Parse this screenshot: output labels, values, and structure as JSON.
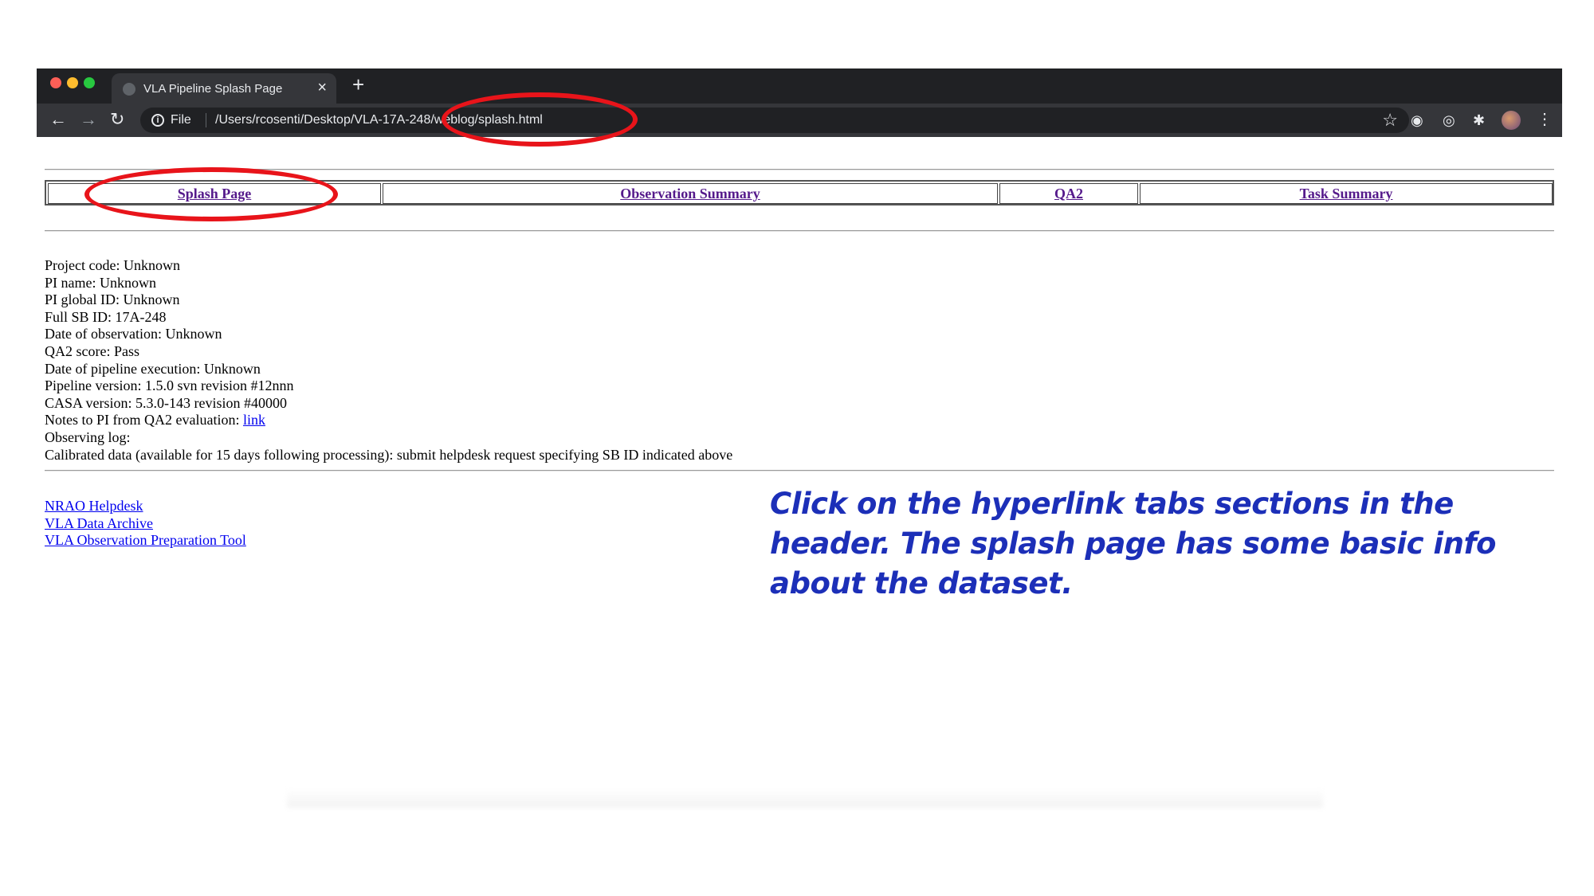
{
  "browser": {
    "tab_title": "VLA Pipeline Splash Page",
    "tab_close": "×",
    "new_tab": "+",
    "scheme_label": "File",
    "url": "/Users/rcosenti/Desktop/VLA-17A-248/weblog/splash.html"
  },
  "nav": {
    "tabs": [
      "Splash Page",
      "Observation Summary",
      "QA2",
      "Task Summary"
    ]
  },
  "info": {
    "project_code": "Project code: Unknown",
    "pi_name": "PI name: Unknown",
    "pi_global_id": "PI global ID: Unknown",
    "full_sb_id": "Full SB ID: 17A-248",
    "date_of_observation": "Date of observation: Unknown",
    "qa2_score": "QA2 score: Pass",
    "date_of_pipeline_execution": "Date of pipeline execution: Unknown",
    "pipeline_version": "Pipeline version: 1.5.0 svn revision #12nnn",
    "casa_version": "CASA version: 5.3.0-143 revision #40000",
    "notes_prefix": "Notes to PI from QA2 evaluation: ",
    "notes_link": "link",
    "observing_log": "Observing log:",
    "calibrated_data": "Calibrated data (available for 15 days following processing): submit helpdesk request specifying SB ID indicated above"
  },
  "footer_links": [
    "NRAO Helpdesk",
    "VLA Data Archive",
    "VLA Observation Preparation Tool"
  ],
  "annotation": "Click on the hyperlink tabs sections in the header. The splash page has some basic info about the dataset.",
  "colors": {
    "annotation": "#1c2fb8",
    "highlight_ring": "#e8141a",
    "visited_link": "#551a8b",
    "link": "#0000ee"
  }
}
